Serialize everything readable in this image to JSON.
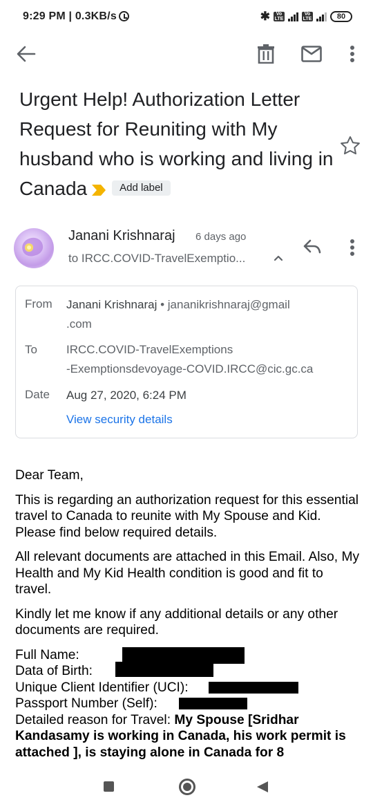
{
  "status_bar": {
    "time": "9:29 PM | 0.3KB/s",
    "network_type": "4G",
    "volte_label": "Vo LTE",
    "battery": "80"
  },
  "toolbar": {
    "back_icon": "arrow-back",
    "delete_icon": "trash",
    "mark_unread_icon": "mail",
    "more_icon": "more-vert"
  },
  "email": {
    "subject": "Urgent Help! Authorization Letter Request for Reuniting with My husband who is working and living in Canada",
    "add_label": "Add label",
    "important_color": "#f4b400",
    "sender_name": "Janani Krishnaraj",
    "sender_time": "6 days ago",
    "to_summary": "to IRCC.COVID-TravelExemptio...",
    "details": {
      "from_label": "From",
      "from_name": "Janani Krishnaraj",
      "from_sep": "•",
      "from_email_line1": "jananikrishnaraj@gmail",
      "from_email_line2": ".com",
      "to_label": "To",
      "to_line1": "IRCC.COVID-TravelExemptions",
      "to_line2": "-Exemptionsdevoyage-COVID.IRCC@cic.gc.ca",
      "date_label": "Date",
      "date_value": "Aug 27, 2020, 6:24 PM",
      "security_link": "View security details"
    },
    "body": {
      "greeting": "Dear Team,",
      "para1": "This is regarding an authorization request for this essential travel to Canada to reunite with My Spouse and Kid. Please find below required details.",
      "para2": "All relevant documents are attached in this Email. Also, My Health and My Kid Health condition is good and fit to travel.",
      "para3": "Kindly let me know if any additional details or any other documents are required.",
      "fields": {
        "full_name": "Full Name:",
        "dob": "Data of Birth:",
        "uci": "Unique Client Identifier (UCI):",
        "passport": "Passport Number (Self):",
        "reason_label": "Detailed reason for Travel:",
        "reason_value": "My Spouse [Sridhar Kandasamy is working in Canada, his work permit is attached ], is staying alone in Canada for 8"
      }
    }
  },
  "colors": {
    "link": "#1a73e8",
    "label_chip_bg": "#eceff1"
  }
}
